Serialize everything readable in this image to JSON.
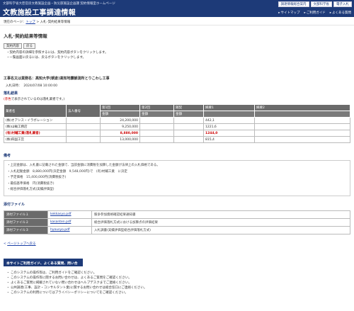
{
  "header": {
    "sup": "文部科学省大臣官房文教施設企画・防災部施設企画課 契約情報室ホームページ",
    "title": "文教施設工事調達情報",
    "top_buttons": [
      "調達情報総合案内",
      "文部科学省",
      "電子入札"
    ],
    "links": [
      "サイトマップ",
      "ご利用ガイド",
      "よくある質問"
    ]
  },
  "breadcrumb": {
    "prefix": "現在のページ：",
    "top": "トップ",
    "sep": " > ",
    "current": "入札･契約結果等情報"
  },
  "page": {
    "title": "入札･契約結果等情報",
    "buttons": [
      "契約内容",
      "戻る"
    ],
    "bullets": [
      "契約内容の詳細を参照するには、契約内容ボタンをクリックします。",
      "一覧画面に戻るには、戻るボタンをクリックします。"
    ]
  },
  "project": {
    "name": "工事名又は業務名：高知大学(朝倉)高知地震観測所とりこわし工事",
    "date_label": "入札日時：",
    "date": "2024/07/08 10:00:00"
  },
  "results": {
    "heading": "落札結果",
    "note_red": "(赤色",
    "note_rest": "で表示されているのは落札業者です。)",
    "headers": [
      "業者名",
      "法人番号",
      "第1回",
      "第2回",
      "随契",
      "摘要1",
      "摘要2"
    ],
    "subheaders": [
      "金額",
      "金額",
      "金額"
    ],
    "rows": [
      {
        "name": "(株)オアシス・イラボレーション",
        "corp": "",
        "r1": "24,200,000",
        "r2": "",
        "zuikei": "",
        "tekiyo1": "442,1",
        "tekiyo2": "",
        "winner": false
      },
      {
        "name": "(株)山輸工務店",
        "corp": "",
        "r1": "9,250,000",
        "r2": "",
        "zuikei": "",
        "tekiyo1": "1221,6",
        "tekiyo2": "",
        "winner": false
      },
      {
        "name": "(有)村輔工業(落札業者)",
        "corp": "",
        "r1": "8,880,000",
        "r2": "",
        "zuikei": "",
        "tekiyo1": "1244,0",
        "tekiyo2": "",
        "winner": true
      },
      {
        "name": "(株)四国工営",
        "corp": "",
        "r1": "13,000,000",
        "r2": "",
        "zuikei": "",
        "tekiyo1": "815,4",
        "tekiyo2": "",
        "winner": false
      }
    ]
  },
  "biko": {
    "heading": "備考",
    "lines": [
      "・上記金額は、入札書に記載された金額で、当該金額に消費税を加算した金額が法律上の入札価格である。",
      "・入札起動金額　8,880,000円(決定金額　9,548,000円)で　(有)村輔工業　に決定",
      "・予定価格　15,400,000円(消費税抜き)",
      "・最低基準価格　円(消費税抜き)",
      "・総合評価落札方式(実績評価型)"
    ]
  },
  "files": {
    "heading": "添付ファイル",
    "rows": [
      {
        "label": "添付ファイル１",
        "file": "kekkasyo.pdf",
        "desc": "競争参加資格確認結果通知書"
      },
      {
        "label": "添付ファイル２",
        "file": "kasanten.pdf",
        "desc": "総合評価落札方式における加算点の評価結果"
      },
      {
        "label": "添付ファイル３",
        "file": "hyousyo.pdf",
        "desc": "入札調書(実績評価型総合評価落札方式)"
      }
    ]
  },
  "back_link": {
    "arrow": "<",
    "text": "ページトップへ戻る"
  },
  "faq": {
    "bar": "本サイトご利用ガイド、よくある質問、問い合わせ先",
    "items": [
      "このシステムの操作等は、ご利用ガイドをご確認ください。",
      "このシステムの操作等に関するお問い合わせは、よくあるご質問をご確認ください。",
      "よくあるご質問に掲載されていない問い合わせはヘルプデスクまでご連絡ください。",
      "公共調達(工事、設計・コンサルタント業)に関するお問い合わせは総合窓口にご連絡ください。",
      "このシステムの利用についてはプライバシーポリシーについてをご確認ください。"
    ]
  }
}
